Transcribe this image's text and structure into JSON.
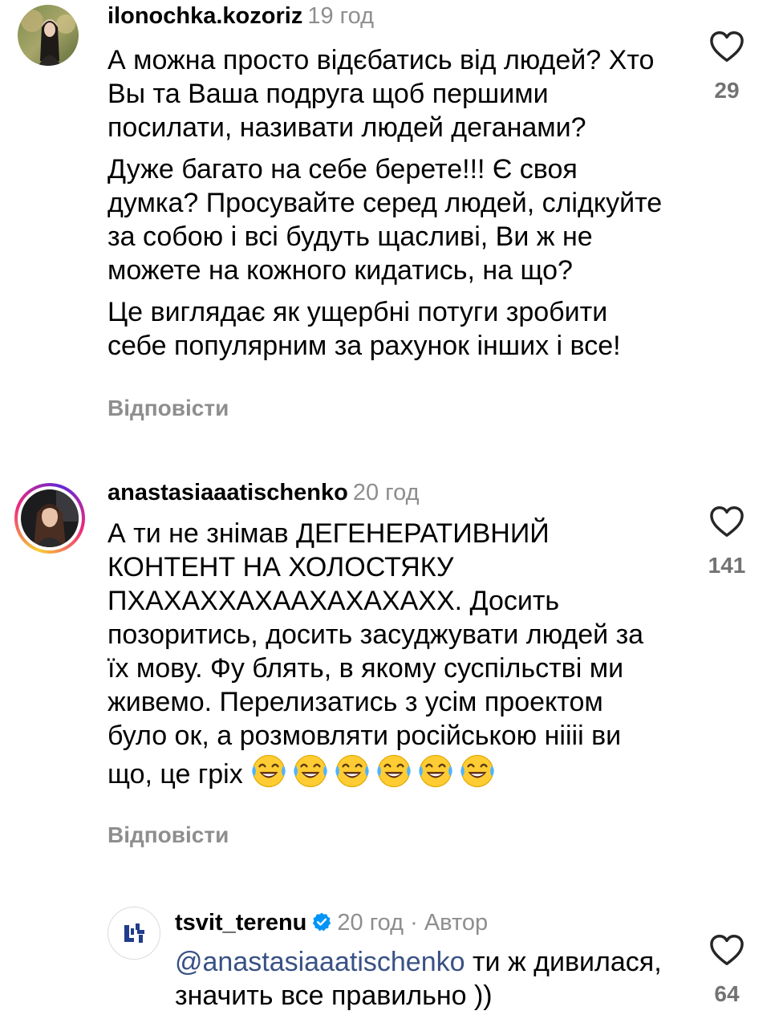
{
  "comments": [
    {
      "username": "ilonochka.kozoriz",
      "time": "19 год",
      "paragraphs": [
        "А можна просто відєбатись від людей? Хто Вы та Ваша подруга щоб першими посилати, називати людей деганами?",
        "Дуже багато на себе берете!!! Є своя думка? Просувайте серед людей, слідкуйте за собою і всі будуть щасливі, Ви ж не можете на кожного кидатись, на що?",
        "Це виглядає як ущербні потуги зробити себе популярним за рахунок інших і все!"
      ],
      "reply_label": "Відповісти",
      "likes": "29"
    },
    {
      "username": "anastasiaaatischenko",
      "time": "20 год",
      "text": "А ти не знімав ДЕГЕНЕРАТИВНИЙ КОНТЕНТ НА ХОЛОСТЯКУ ПХАХАХХАХААХАХАХАХХ. Досить позоритись, досить засуджувати людей за їх мову. Фу блять, в якому суспільстві ми живемо. Перелизатись з усім проектом було ок, а розмовляти російською нііii ви що, це гріх",
      "emoji_name": "face-with-tears-of-joy",
      "emoji_count": 6,
      "reply_label": "Відповісти",
      "likes": "141"
    }
  ],
  "reply": {
    "username": "tsvit_terenu",
    "time": "20 год",
    "author_label": "· Автор",
    "mention": "@anastasiaaatischenko",
    "text": " ти ж дивилася, значить все правильно ))",
    "likes": "64",
    "verified_icon": "verified-badge-icon",
    "verified_color": "#0095f6"
  },
  "icons": {
    "like": "heart-outline-icon",
    "like_color": "#262626"
  }
}
